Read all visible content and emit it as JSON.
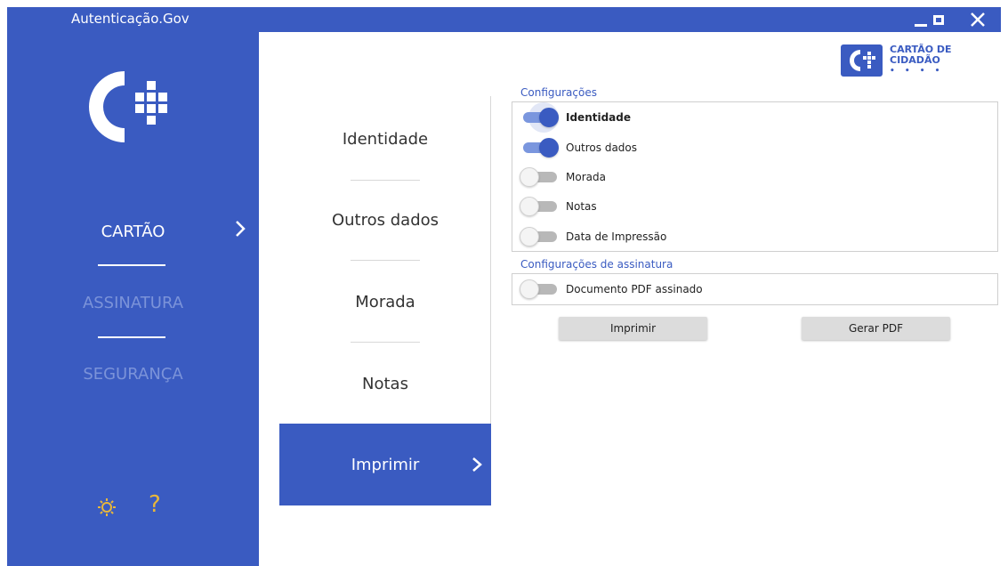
{
  "window": {
    "title": "Autenticação.Gov",
    "minimize": "_",
    "maximize": "□",
    "close": "✕"
  },
  "sidebar": {
    "items": [
      {
        "label": "CARTÃO",
        "active": true
      },
      {
        "label": "ASSINATURA",
        "active": false
      },
      {
        "label": "SEGURANÇA",
        "active": false
      }
    ],
    "help_label": "?"
  },
  "brand": {
    "logo_text": "CARTÃO DE CIDADÃO",
    "logo_dots": "• • • •",
    "primary_color": "#3a5bc1",
    "help_color": "#e8b73b"
  },
  "submenu": {
    "items": [
      "Identidade",
      "Outros dados",
      "Morada",
      "Notas",
      "Imprimir"
    ],
    "active_index": 4
  },
  "settings": {
    "section_title": "Configurações",
    "options": [
      {
        "label": "Identidade",
        "on": true
      },
      {
        "label": "Outros dados",
        "on": true
      },
      {
        "label": "Morada",
        "on": false
      },
      {
        "label": "Notas",
        "on": false
      },
      {
        "label": "Data de Impressão",
        "on": false
      }
    ]
  },
  "signature_settings": {
    "section_title": "Configurações de assinatura",
    "options": [
      {
        "label": "Documento PDF assinado",
        "on": false
      }
    ]
  },
  "actions": {
    "print_label": "Imprimir",
    "pdf_label": "Gerar PDF"
  }
}
